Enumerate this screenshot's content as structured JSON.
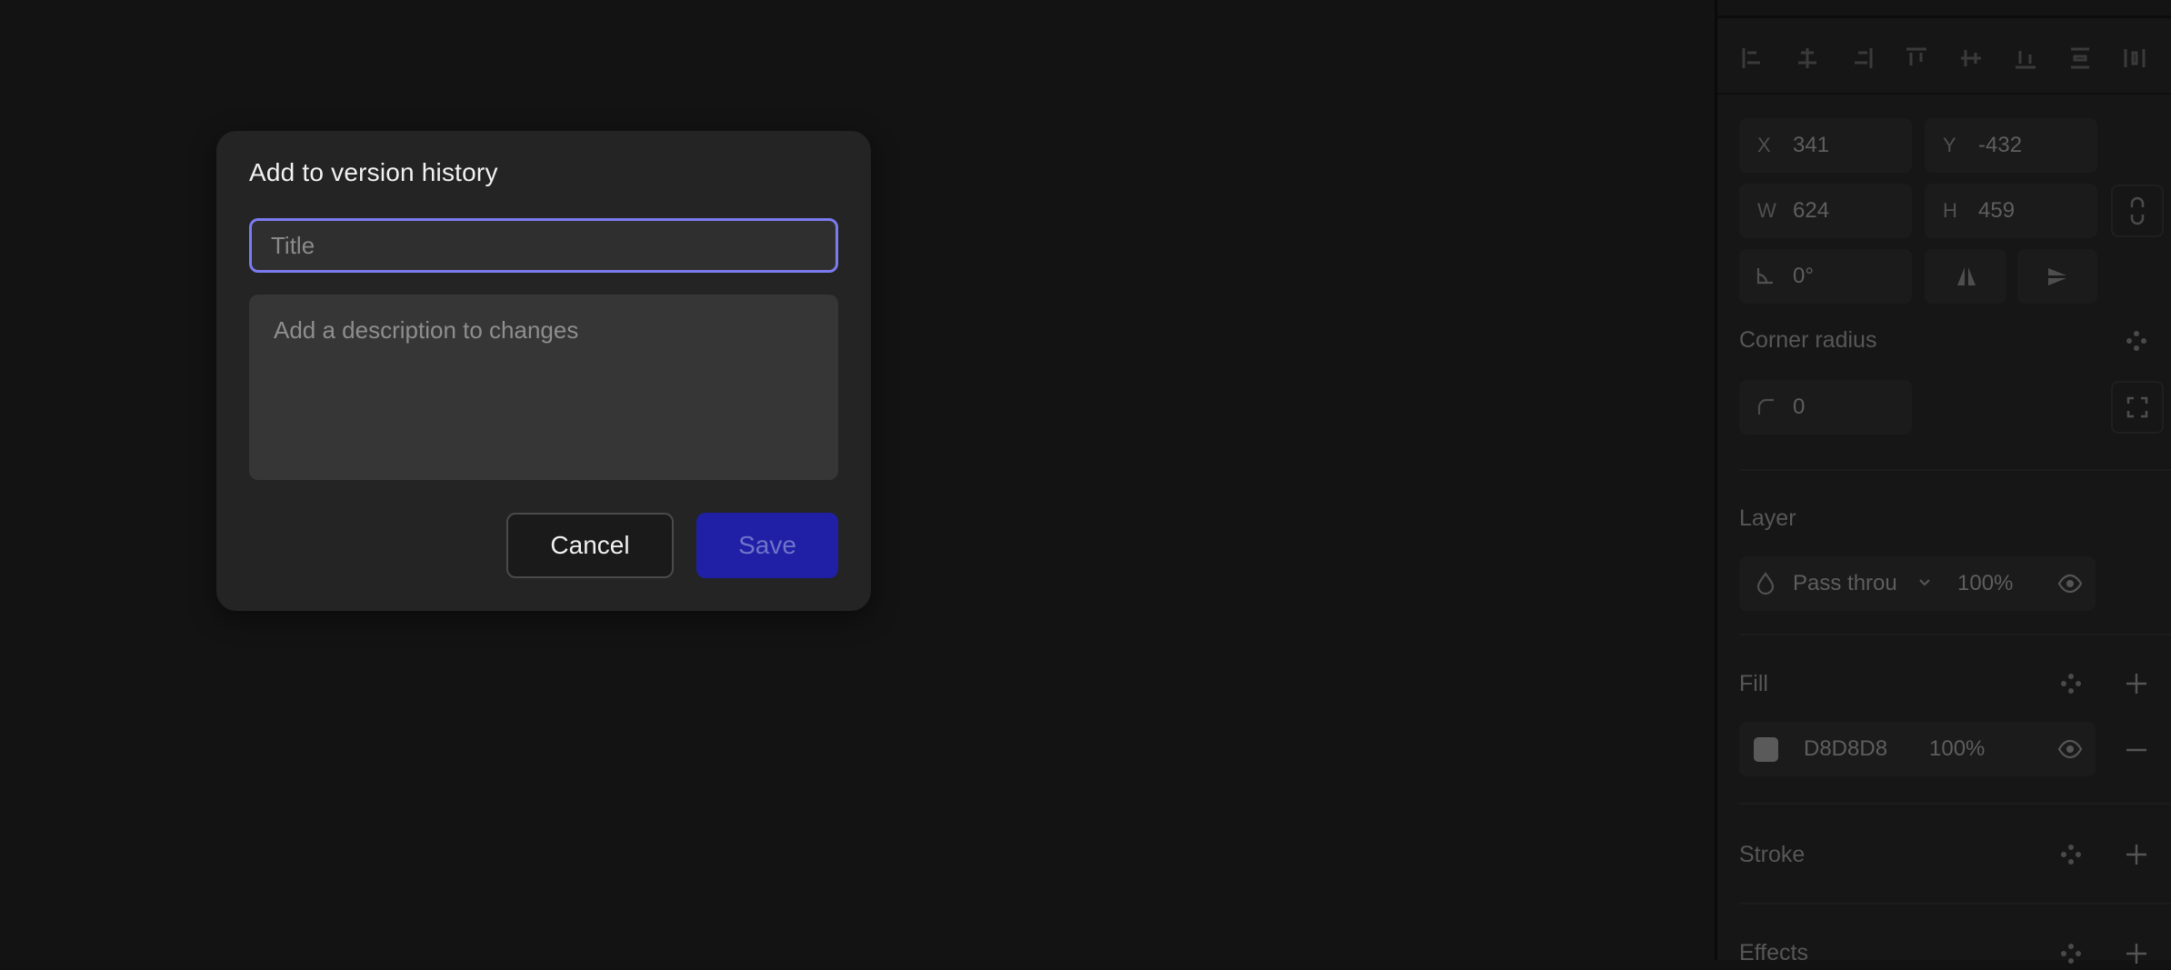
{
  "dialog": {
    "title": "Add to version history",
    "title_placeholder": "Title",
    "description_placeholder": "Add a description to changes",
    "cancel_label": "Cancel",
    "save_label": "Save"
  },
  "properties": {
    "x_label": "X",
    "x_value": "341",
    "y_label": "Y",
    "y_value": "-432",
    "w_label": "W",
    "w_value": "624",
    "h_label": "H",
    "h_value": "459",
    "rotation_value": "0°",
    "corner_radius_label": "Corner radius",
    "corner_radius_value": "0",
    "layer_label": "Layer",
    "blend_mode": "Pass throu",
    "layer_opacity": "100%",
    "fill_label": "Fill",
    "fill_hex": "D8D8D8",
    "fill_opacity": "100%",
    "fill_swatch_color": "#5a5a5a",
    "stroke_label": "Stroke",
    "effects_label": "Effects"
  },
  "colors": {
    "accent": "#7b7bf0",
    "save_button": "#1f20a6"
  }
}
